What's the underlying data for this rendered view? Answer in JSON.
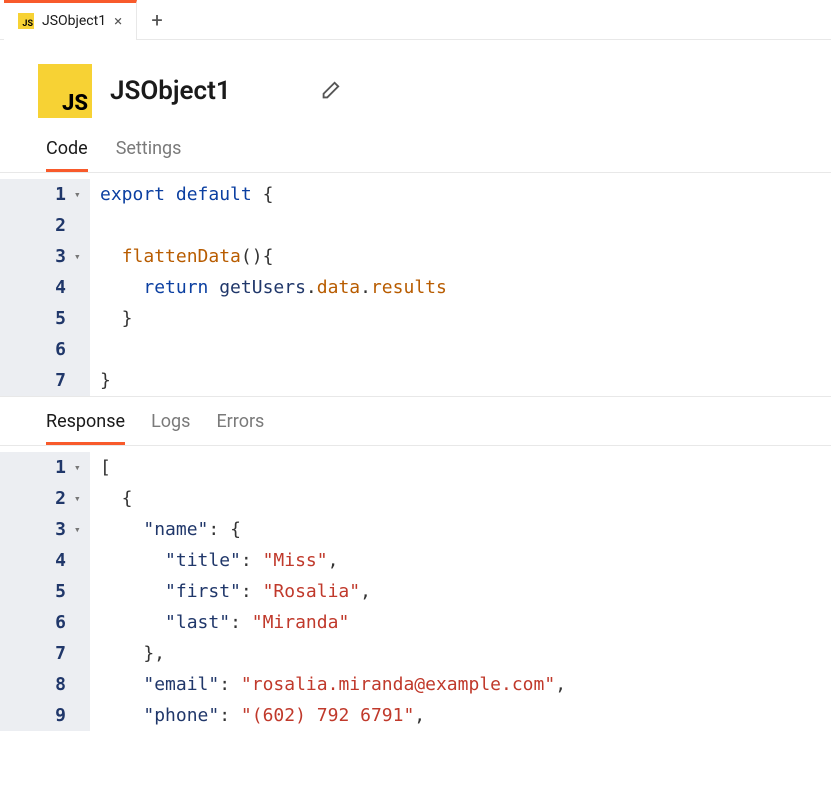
{
  "file_tab": {
    "label": "JSObject1"
  },
  "header": {
    "title": "JSObject1",
    "js_label": "JS"
  },
  "subtabs": {
    "code": "Code",
    "settings": "Settings"
  },
  "out_tabs": {
    "response": "Response",
    "logs": "Logs",
    "errors": "Errors"
  },
  "code_lines": [
    {
      "n": "1",
      "fold": "▾",
      "tokens": [
        [
          "kw",
          "export "
        ],
        [
          "kw",
          "default "
        ],
        [
          "pun",
          "{"
        ]
      ]
    },
    {
      "n": "2",
      "fold": "",
      "tokens": []
    },
    {
      "n": "3",
      "fold": "▾",
      "tokens": [
        [
          "pun",
          "  "
        ],
        [
          "fn",
          "flattenData"
        ],
        [
          "pun",
          "(){"
        ]
      ]
    },
    {
      "n": "4",
      "fold": "",
      "tokens": [
        [
          "pun",
          "    "
        ],
        [
          "kw",
          "return "
        ],
        [
          "id",
          "getUsers"
        ],
        [
          "pun",
          "."
        ],
        [
          "prop",
          "data"
        ],
        [
          "pun",
          "."
        ],
        [
          "prop",
          "results"
        ]
      ]
    },
    {
      "n": "5",
      "fold": "",
      "tokens": [
        [
          "pun",
          "  }"
        ]
      ]
    },
    {
      "n": "6",
      "fold": "",
      "tokens": []
    },
    {
      "n": "7",
      "fold": "",
      "tokens": [
        [
          "pun",
          "}"
        ]
      ]
    }
  ],
  "json_lines": [
    {
      "n": "1",
      "fold": "▾",
      "tokens": [
        [
          "pun",
          "["
        ]
      ]
    },
    {
      "n": "2",
      "fold": "▾",
      "tokens": [
        [
          "pun",
          "  {"
        ]
      ]
    },
    {
      "n": "3",
      "fold": "▾",
      "tokens": [
        [
          "pun",
          "    "
        ],
        [
          "jkey",
          "\"name\""
        ],
        [
          "pun",
          ": {"
        ]
      ]
    },
    {
      "n": "4",
      "fold": "",
      "tokens": [
        [
          "pun",
          "      "
        ],
        [
          "jkey",
          "\"title\""
        ],
        [
          "pun",
          ": "
        ],
        [
          "str",
          "\"Miss\""
        ],
        [
          "pun",
          ","
        ]
      ]
    },
    {
      "n": "5",
      "fold": "",
      "tokens": [
        [
          "pun",
          "      "
        ],
        [
          "jkey",
          "\"first\""
        ],
        [
          "pun",
          ": "
        ],
        [
          "str",
          "\"Rosalia\""
        ],
        [
          "pun",
          ","
        ]
      ]
    },
    {
      "n": "6",
      "fold": "",
      "tokens": [
        [
          "pun",
          "      "
        ],
        [
          "jkey",
          "\"last\""
        ],
        [
          "pun",
          ": "
        ],
        [
          "str",
          "\"Miranda\""
        ]
      ]
    },
    {
      "n": "7",
      "fold": "",
      "tokens": [
        [
          "pun",
          "    },"
        ]
      ]
    },
    {
      "n": "8",
      "fold": "",
      "tokens": [
        [
          "pun",
          "    "
        ],
        [
          "jkey",
          "\"email\""
        ],
        [
          "pun",
          ": "
        ],
        [
          "str",
          "\"rosalia.miranda@example.com\""
        ],
        [
          "pun",
          ","
        ]
      ]
    },
    {
      "n": "9",
      "fold": "",
      "tokens": [
        [
          "pun",
          "    "
        ],
        [
          "jkey",
          "\"phone\""
        ],
        [
          "pun",
          ": "
        ],
        [
          "str",
          "\"(602) 792 6791\""
        ],
        [
          "pun",
          ","
        ]
      ]
    }
  ]
}
